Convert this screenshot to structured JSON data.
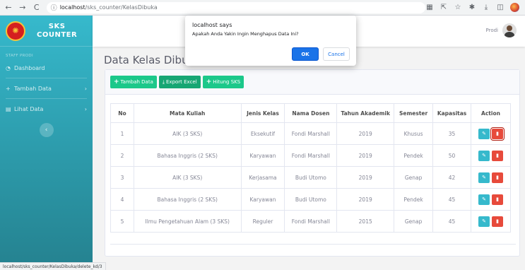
{
  "browser": {
    "url_host": "localhost",
    "url_path": "/sks_counter/KelasDibuka"
  },
  "sidebar": {
    "brand_line1": "SKS",
    "brand_line2": "COUNTER",
    "section_heading": "STAFF PRODI",
    "items": [
      {
        "label": "Dashboard",
        "icon": "dashboard-icon"
      },
      {
        "label": "Tambah Data",
        "icon": "plus-icon"
      },
      {
        "label": "Lihat Data",
        "icon": "document-icon"
      }
    ]
  },
  "topbar": {
    "user_name": "Prodi"
  },
  "page": {
    "title": "Data Kelas Dibuka"
  },
  "toolbar": {
    "add_label": "Tambah Data",
    "export_label": "Export Excel",
    "count_label": "Hitung SKS"
  },
  "table": {
    "headers": [
      "No",
      "Mata Kuliah",
      "Jenis Kelas",
      "Nama Dosen",
      "Tahun Akademik",
      "Semester",
      "Kapasitas",
      "Action"
    ],
    "rows": [
      [
        "1",
        "AIK (3 SKS)",
        "Eksekutif",
        "Fondi Marshall",
        "2019",
        "Khusus",
        "35"
      ],
      [
        "2",
        "Bahasa Inggris (2 SKS)",
        "Karyawan",
        "Fondi Marshall",
        "2019",
        "Pendek",
        "50"
      ],
      [
        "3",
        "AIK (3 SKS)",
        "Kerjasama",
        "Budi Utomo",
        "2019",
        "Genap",
        "42"
      ],
      [
        "4",
        "Bahasa Inggris (2 SKS)",
        "Karyawan",
        "Budi Utomo",
        "2019",
        "Pendek",
        "45"
      ],
      [
        "5",
        "Ilmu Pengetahuan Alam (3 SKS)",
        "Reguler",
        "Fondi Marshall",
        "2015",
        "Genap",
        "45"
      ]
    ]
  },
  "dialog": {
    "title": "localhost says",
    "message": "Apakah Anda Yakin Ingin Menghapus Data Ini?",
    "ok_label": "OK",
    "cancel_label": "Cancel"
  },
  "status_bar": {
    "text": "localhost/sks_counter/KelasDibuka/delete_kd/3"
  },
  "colors": {
    "sidebar_top": "#36b9cc",
    "sidebar_bottom": "#258391",
    "success": "#1cc88a",
    "info": "#36b9cc",
    "danger": "#e74a3b",
    "dialog_primary": "#1a73e8"
  }
}
